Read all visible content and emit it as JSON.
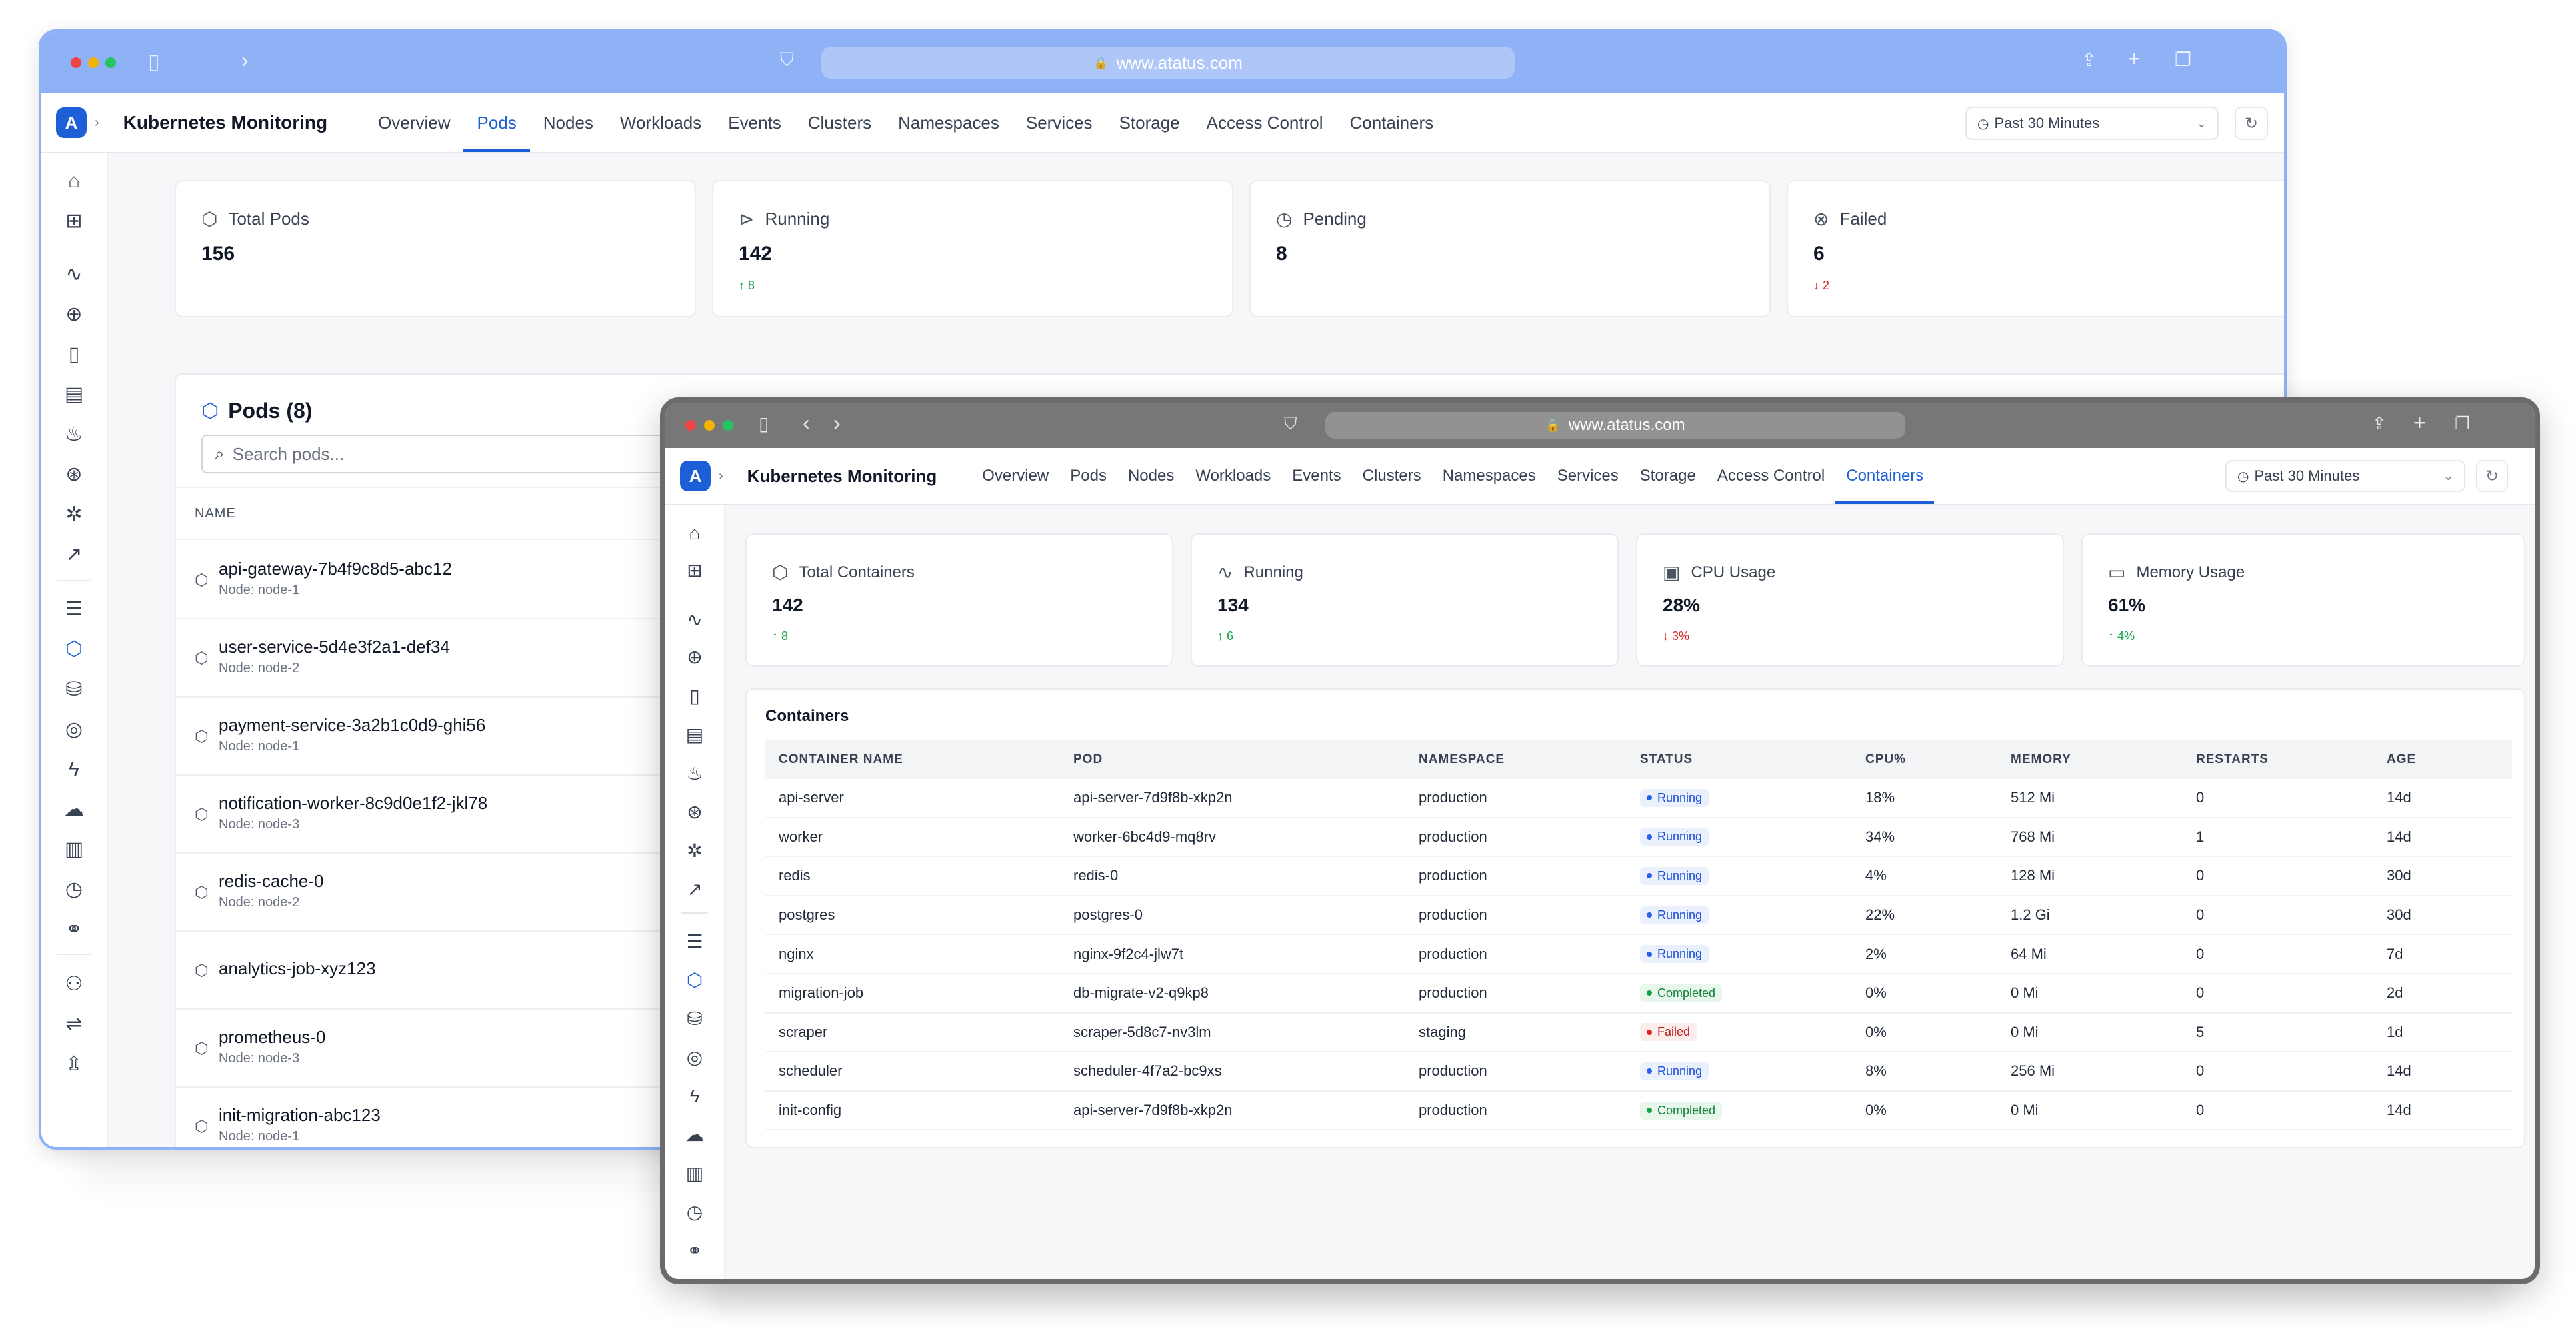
{
  "browser": {
    "url": "www.atatus.com"
  },
  "app": {
    "title": "Kubernetes Monitoring",
    "logo": "A"
  },
  "time_selector": "Past 30 Minutes",
  "colors": {
    "accent": "#1d5fd6",
    "back_frame": "#8fb1f5",
    "front_frame": "#777777",
    "up": "#16a34a",
    "down": "#dc2626"
  },
  "nav": [
    "Overview",
    "Pods",
    "Nodes",
    "Workloads",
    "Events",
    "Clusters",
    "Namespaces",
    "Services",
    "Storage",
    "Access Control",
    "Containers"
  ],
  "back": {
    "active_tab": "Pods",
    "cards": [
      {
        "label": "Total Pods",
        "value": "156",
        "delta": "",
        "icon": "box-icon"
      },
      {
        "label": "Running",
        "value": "142",
        "delta": "↑ 8",
        "dir": "up",
        "icon": "play-icon"
      },
      {
        "label": "Pending",
        "value": "8",
        "delta": "",
        "icon": "clock-icon"
      },
      {
        "label": "Failed",
        "value": "6",
        "delta": "↓ 2",
        "dir": "down",
        "icon": "x-circle-icon"
      }
    ],
    "pods_title": "Pods (8)",
    "search_placeholder": "Search pods...",
    "name_header": "NAME",
    "pods": [
      {
        "name": "api-gateway-7b4f9c8d5-abc12",
        "node": "Node: node-1"
      },
      {
        "name": "user-service-5d4e3f2a1-def34",
        "node": "Node: node-2"
      },
      {
        "name": "payment-service-3a2b1c0d9-ghi56",
        "node": "Node: node-1"
      },
      {
        "name": "notification-worker-8c9d0e1f2-jkl78",
        "node": "Node: node-3"
      },
      {
        "name": "redis-cache-0",
        "node": "Node: node-2"
      },
      {
        "name": "analytics-job-xyz123",
        "node": ""
      },
      {
        "name": "prometheus-0",
        "node": "Node: node-3"
      },
      {
        "name": "init-migration-abc123",
        "node": "Node: node-1"
      }
    ]
  },
  "front": {
    "active_tab": "Containers",
    "cards": [
      {
        "label": "Total Containers",
        "value": "142",
        "delta": "↑ 8",
        "dir": "up",
        "icon": "box-icon"
      },
      {
        "label": "Running",
        "value": "134",
        "delta": "↑ 6",
        "dir": "up",
        "icon": "activity-icon"
      },
      {
        "label": "CPU Usage",
        "value": "28%",
        "delta": "↓ 3%",
        "dir": "down",
        "icon": "cpu-icon"
      },
      {
        "label": "Memory Usage",
        "value": "61%",
        "delta": "↑ 4%",
        "dir": "up",
        "icon": "memory-icon"
      }
    ],
    "table_title": "Containers",
    "columns": [
      "CONTAINER NAME",
      "POD",
      "NAMESPACE",
      "STATUS",
      "CPU%",
      "MEMORY",
      "RESTARTS",
      "AGE"
    ],
    "rows": [
      [
        "api-server",
        "api-server-7d9f8b-xkp2n",
        "production",
        "Running",
        "18%",
        "512 Mi",
        "0",
        "14d"
      ],
      [
        "worker",
        "worker-6bc4d9-mq8rv",
        "production",
        "Running",
        "34%",
        "768 Mi",
        "1",
        "14d"
      ],
      [
        "redis",
        "redis-0",
        "production",
        "Running",
        "4%",
        "128 Mi",
        "0",
        "30d"
      ],
      [
        "postgres",
        "postgres-0",
        "production",
        "Running",
        "22%",
        "1.2 Gi",
        "0",
        "30d"
      ],
      [
        "nginx",
        "nginx-9f2c4-jlw7t",
        "production",
        "Running",
        "2%",
        "64 Mi",
        "0",
        "7d"
      ],
      [
        "migration-job",
        "db-migrate-v2-q9kp8",
        "production",
        "Completed",
        "0%",
        "0 Mi",
        "0",
        "2d"
      ],
      [
        "scraper",
        "scraper-5d8c7-nv3lm",
        "staging",
        "Failed",
        "0%",
        "0 Mi",
        "5",
        "1d"
      ],
      [
        "scheduler",
        "scheduler-4f7a2-bc9xs",
        "production",
        "Running",
        "8%",
        "256 Mi",
        "0",
        "14d"
      ],
      [
        "init-config",
        "api-server-7d9f8b-xkp2n",
        "production",
        "Completed",
        "0%",
        "0 Mi",
        "0",
        "14d"
      ]
    ]
  }
}
